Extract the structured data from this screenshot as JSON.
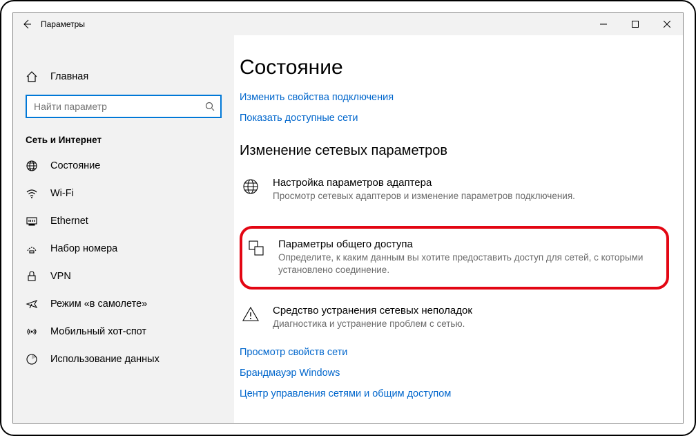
{
  "titlebar": {
    "title": "Параметры"
  },
  "sidebar": {
    "home_label": "Главная",
    "search_placeholder": "Найти параметр",
    "group_label": "Сеть и Интернет",
    "items": [
      {
        "label": "Состояние"
      },
      {
        "label": "Wi-Fi"
      },
      {
        "label": "Ethernet"
      },
      {
        "label": "Набор номера"
      },
      {
        "label": "VPN"
      },
      {
        "label": "Режим «в самолете»"
      },
      {
        "label": "Мобильный хот-спот"
      },
      {
        "label": "Использование данных"
      }
    ]
  },
  "content": {
    "heading": "Состояние",
    "links_top": [
      "Изменить свойства подключения",
      "Показать доступные сети"
    ],
    "section_title": "Изменение сетевых параметров",
    "items": [
      {
        "title": "Настройка параметров адаптера",
        "desc": "Просмотр сетевых адаптеров и изменение параметров подключения."
      },
      {
        "title": "Параметры общего доступа",
        "desc": "Определите, к каким данным вы хотите предоставить доступ для сетей, с которыми установлено соединение."
      },
      {
        "title": "Средство устранения сетевых неполадок",
        "desc": "Диагностика и устранение проблем с сетью."
      }
    ],
    "links_bottom": [
      "Просмотр свойств сети",
      "Брандмауэр Windows",
      "Центр управления сетями и общим доступом"
    ]
  }
}
